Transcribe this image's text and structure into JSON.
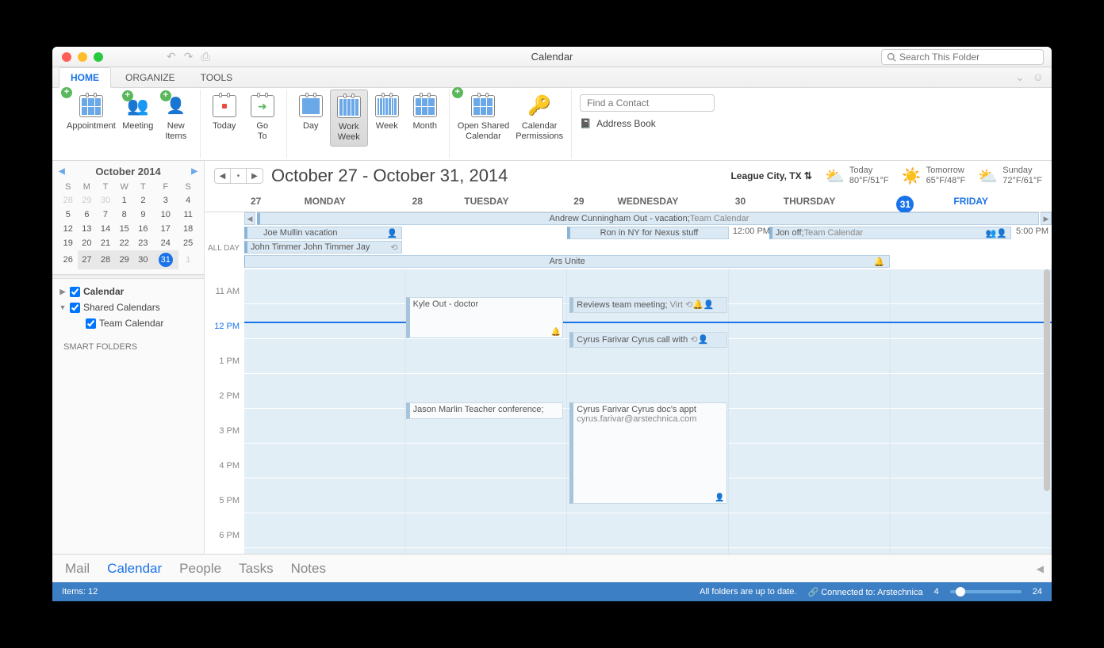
{
  "window_title": "Calendar",
  "search_placeholder": "Search This Folder",
  "tabs": {
    "home": "HOME",
    "organize": "ORGANIZE",
    "tools": "TOOLS"
  },
  "ribbon": {
    "appointment": "Appointment",
    "meeting": "Meeting",
    "new_items": "New\nItems",
    "today": "Today",
    "goto": "Go\nTo",
    "day": "Day",
    "work_week": "Work\nWeek",
    "week": "Week",
    "month": "Month",
    "open_shared": "Open Shared\nCalendar",
    "permissions": "Calendar\nPermissions",
    "find_contact": "Find a Contact",
    "address_book": "Address Book"
  },
  "minical": {
    "title": "October 2014",
    "dow": [
      "S",
      "M",
      "T",
      "W",
      "T",
      "F",
      "S"
    ],
    "weeks": [
      [
        {
          "d": 28,
          "o": true
        },
        {
          "d": 29,
          "o": true
        },
        {
          "d": 30,
          "o": true
        },
        {
          "d": 1
        },
        {
          "d": 2
        },
        {
          "d": 3
        },
        {
          "d": 4
        }
      ],
      [
        {
          "d": 5
        },
        {
          "d": 6
        },
        {
          "d": 7
        },
        {
          "d": 8
        },
        {
          "d": 9
        },
        {
          "d": 10
        },
        {
          "d": 11
        }
      ],
      [
        {
          "d": 12
        },
        {
          "d": 13
        },
        {
          "d": 14
        },
        {
          "d": 15
        },
        {
          "d": 16
        },
        {
          "d": 17
        },
        {
          "d": 18
        }
      ],
      [
        {
          "d": 19
        },
        {
          "d": 20
        },
        {
          "d": 21
        },
        {
          "d": 22
        },
        {
          "d": 23
        },
        {
          "d": 24
        },
        {
          "d": 25
        }
      ],
      [
        {
          "d": 26
        },
        {
          "d": 27,
          "hl": true
        },
        {
          "d": 28,
          "hl": true
        },
        {
          "d": 29,
          "hl": true
        },
        {
          "d": 30,
          "hl": true
        },
        {
          "d": 31,
          "hl": true,
          "today": true
        },
        {
          "d": 1,
          "o": true
        }
      ]
    ]
  },
  "tree": {
    "calendar": "Calendar",
    "shared": "Shared Calendars",
    "team": "Team Calendar",
    "smart": "SMART FOLDERS"
  },
  "range": "October 27 - October 31, 2014",
  "location": "League City, TX",
  "weather": [
    {
      "label": "Today",
      "temps": "80°F/51°F",
      "icon": "⛅"
    },
    {
      "label": "Tomorrow",
      "temps": "65°F/48°F",
      "icon": "☀️"
    },
    {
      "label": "Sunday",
      "temps": "72°F/61°F",
      "icon": "⛅"
    }
  ],
  "days": [
    {
      "num": "27",
      "label": "MONDAY"
    },
    {
      "num": "28",
      "label": "TUESDAY"
    },
    {
      "num": "29",
      "label": "WEDNESDAY"
    },
    {
      "num": "30",
      "label": "THURSDAY"
    },
    {
      "num": "31",
      "label": "FRIDAY",
      "active": true
    }
  ],
  "allday_label": "ALL DAY",
  "allday": {
    "row1": {
      "text": "Andrew Cunningham Out - vacation;",
      "meta": " Team Calendar"
    },
    "row2a": {
      "text": "Joe Mullin vacation"
    },
    "row2b": {
      "text": "Ron in NY for Nexus stuff"
    },
    "row2c_time": "12:00 PM",
    "row2c": {
      "text": "Jon off;",
      "meta": " Team Calendar"
    },
    "row2c_end": "5:00 PM",
    "row3": {
      "text": "John Timmer John Timmer Jay"
    },
    "row4": {
      "text": "Ars Unite"
    }
  },
  "times": [
    "11 AM",
    "12 PM",
    "1 PM",
    "2 PM",
    "3 PM",
    "4 PM",
    "5 PM",
    "6 PM"
  ],
  "events": {
    "kyle": "Kyle Out - doctor",
    "reviews": {
      "a": "Reviews team meeting;",
      "b": " Virt"
    },
    "cyruscall": "Cyrus Farivar Cyrus call with",
    "jason": "Jason Marlin Teacher conference;",
    "cyrusdoc": {
      "a": "Cyrus Farivar Cyrus doc's appt",
      "b": "cyrus.farivar@arstechnica.com"
    }
  },
  "bottom": {
    "mail": "Mail",
    "calendar": "Calendar",
    "people": "People",
    "tasks": "Tasks",
    "notes": "Notes"
  },
  "status": {
    "items": "Items: 12",
    "uptodate": "All folders are up to date.",
    "connected": "Connected to: Arstechnica",
    "zoom_min": "4",
    "zoom_max": "24"
  }
}
